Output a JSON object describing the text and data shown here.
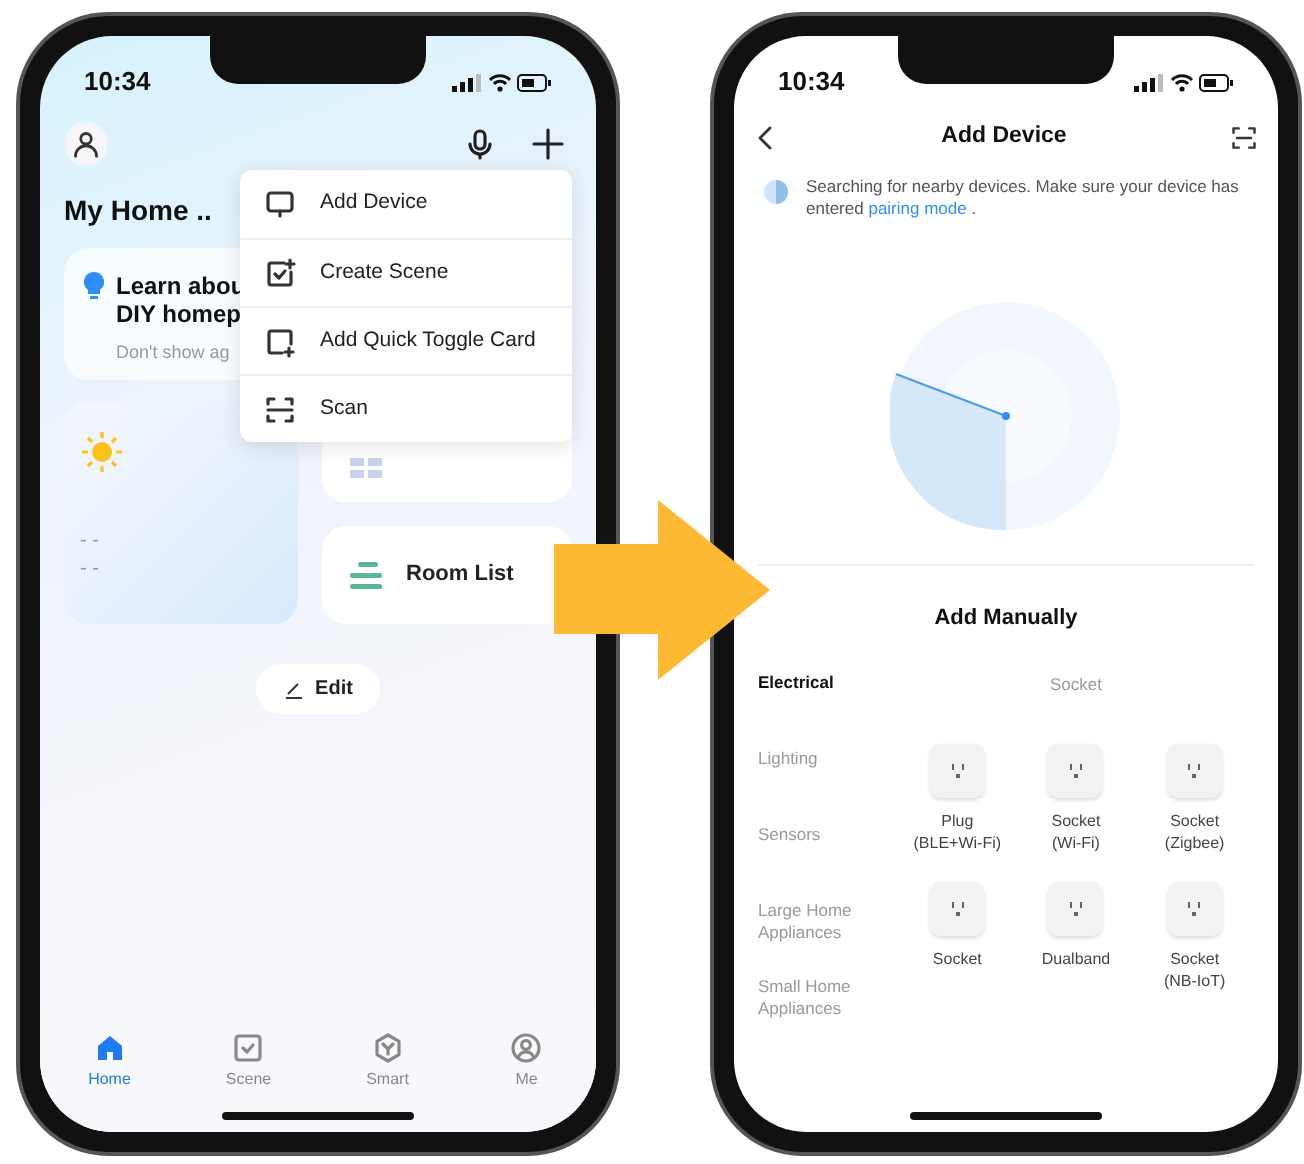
{
  "home_screen": {
    "status_bar": {
      "time": "10:34"
    },
    "title": "My Home ..",
    "tip_card": {
      "lines": [
        "Learn abou",
        "DIY homep"
      ],
      "dismiss": "Don't show ag"
    },
    "weather_readings": [
      "- -",
      "- -"
    ],
    "room_list": "Room List",
    "edit_button": "Edit",
    "menu": [
      {
        "kind": "device",
        "label": "Add Device"
      },
      {
        "kind": "scene",
        "label": "Create Scene"
      },
      {
        "kind": "card",
        "label": "Add Quick Toggle Card"
      },
      {
        "kind": "scan",
        "label": "Scan"
      }
    ],
    "nav": [
      {
        "kind": "home",
        "label": "Home",
        "selected": true
      },
      {
        "kind": "scene",
        "label": "Scene",
        "selected": false
      },
      {
        "kind": "smart",
        "label": "Smart",
        "selected": false
      },
      {
        "kind": "me",
        "label": "Me",
        "selected": false
      }
    ]
  },
  "add_device_screen": {
    "status_bar": {
      "time": "10:34"
    },
    "title": "Add Device",
    "searching_text": "Searching for nearby devices. Make sure your device has entered",
    "pairing_link": "pairing mode",
    "after_link": ".",
    "section_title": "Add Manually",
    "categories": [
      {
        "label": "Electrical",
        "selected": true
      },
      {
        "label": "Lighting",
        "selected": false
      },
      {
        "label": "Sensors",
        "selected": false
      },
      {
        "label": "Large Home Appliances",
        "selected": false
      },
      {
        "label": "Small Home Appliances",
        "selected": false
      }
    ],
    "group_title": "Socket",
    "devices": [
      {
        "lines": [
          "Plug",
          "(BLE+Wi-Fi)"
        ]
      },
      {
        "lines": [
          "Socket",
          "(Wi-Fi)"
        ]
      },
      {
        "lines": [
          "Socket",
          "(Zigbee)"
        ]
      },
      {
        "lines": [
          "Socket"
        ]
      },
      {
        "lines": [
          "Dualband"
        ]
      },
      {
        "lines": [
          "Socket",
          "(NB-IoT)"
        ]
      }
    ]
  }
}
